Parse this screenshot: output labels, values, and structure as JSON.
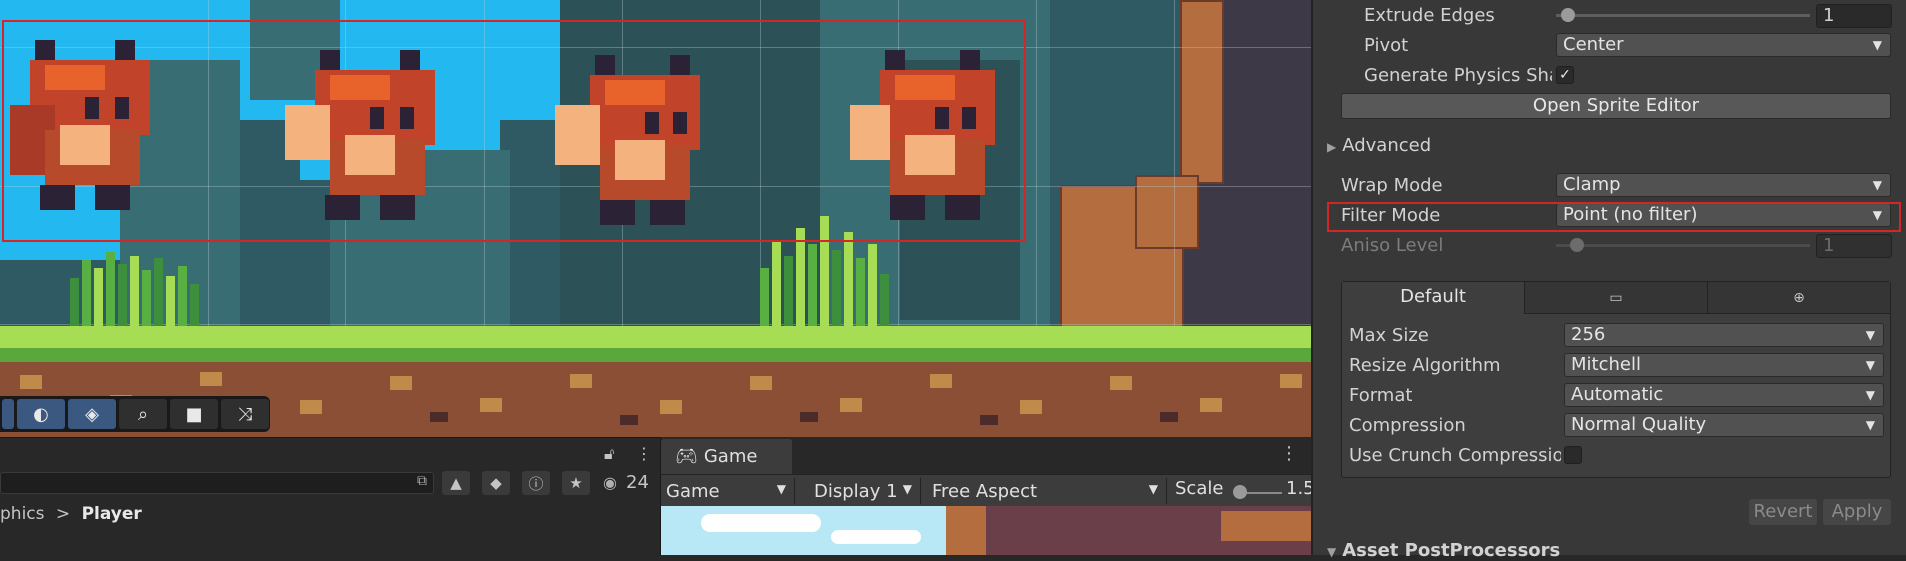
{
  "scene": {
    "toolbar_icons": [
      "moon-icon",
      "layers-icon",
      "zoom-icon",
      "camera-icon",
      "shuffle-icon"
    ]
  },
  "hierarchy": {
    "count": "24",
    "breadcrumb_parent": "phics",
    "breadcrumb_sep": ">",
    "breadcrumb_current": "Player"
  },
  "game": {
    "tab_label": "Game",
    "view_select": "Game",
    "display_select": "Display 1",
    "aspect_select": "Free Aspect",
    "scale_label": "Scale",
    "scale_value": "1.5",
    "scale_fraction": 0.2
  },
  "inspector": {
    "extrude_edges_label": "Extrude Edges",
    "extrude_edges_value": "1",
    "extrude_edges_fraction": 0.04,
    "pivot_label": "Pivot",
    "pivot_value": "Center",
    "generate_physics_label": "Generate Physics Sha",
    "generate_physics_checked": "✓",
    "open_sprite_editor": "Open Sprite Editor",
    "advanced_label": "Advanced",
    "wrap_mode_label": "Wrap Mode",
    "wrap_mode_value": "Clamp",
    "filter_mode_label": "Filter Mode",
    "filter_mode_value": "Point (no filter)",
    "aniso_level_label": "Aniso Level",
    "aniso_level_value": "1",
    "aniso_level_fraction": 0.08,
    "platform_tabs": [
      "Default",
      "",
      ""
    ],
    "max_size_label": "Max Size",
    "max_size_value": "256",
    "resize_algorithm_label": "Resize Algorithm",
    "resize_algorithm_value": "Mitchell",
    "format_label": "Format",
    "format_value": "Automatic",
    "compression_label": "Compression",
    "compression_value": "Normal Quality",
    "crunch_label": "Use Crunch Compressior",
    "revert_label": "Revert",
    "apply_label": "Apply",
    "asset_postprocessors_label": "Asset PostProcessors"
  },
  "colors": {
    "sky": "#23b8f0",
    "highlight_red": "#d32626",
    "grass": "#a6dd54",
    "dirt": "#8a4f34"
  }
}
